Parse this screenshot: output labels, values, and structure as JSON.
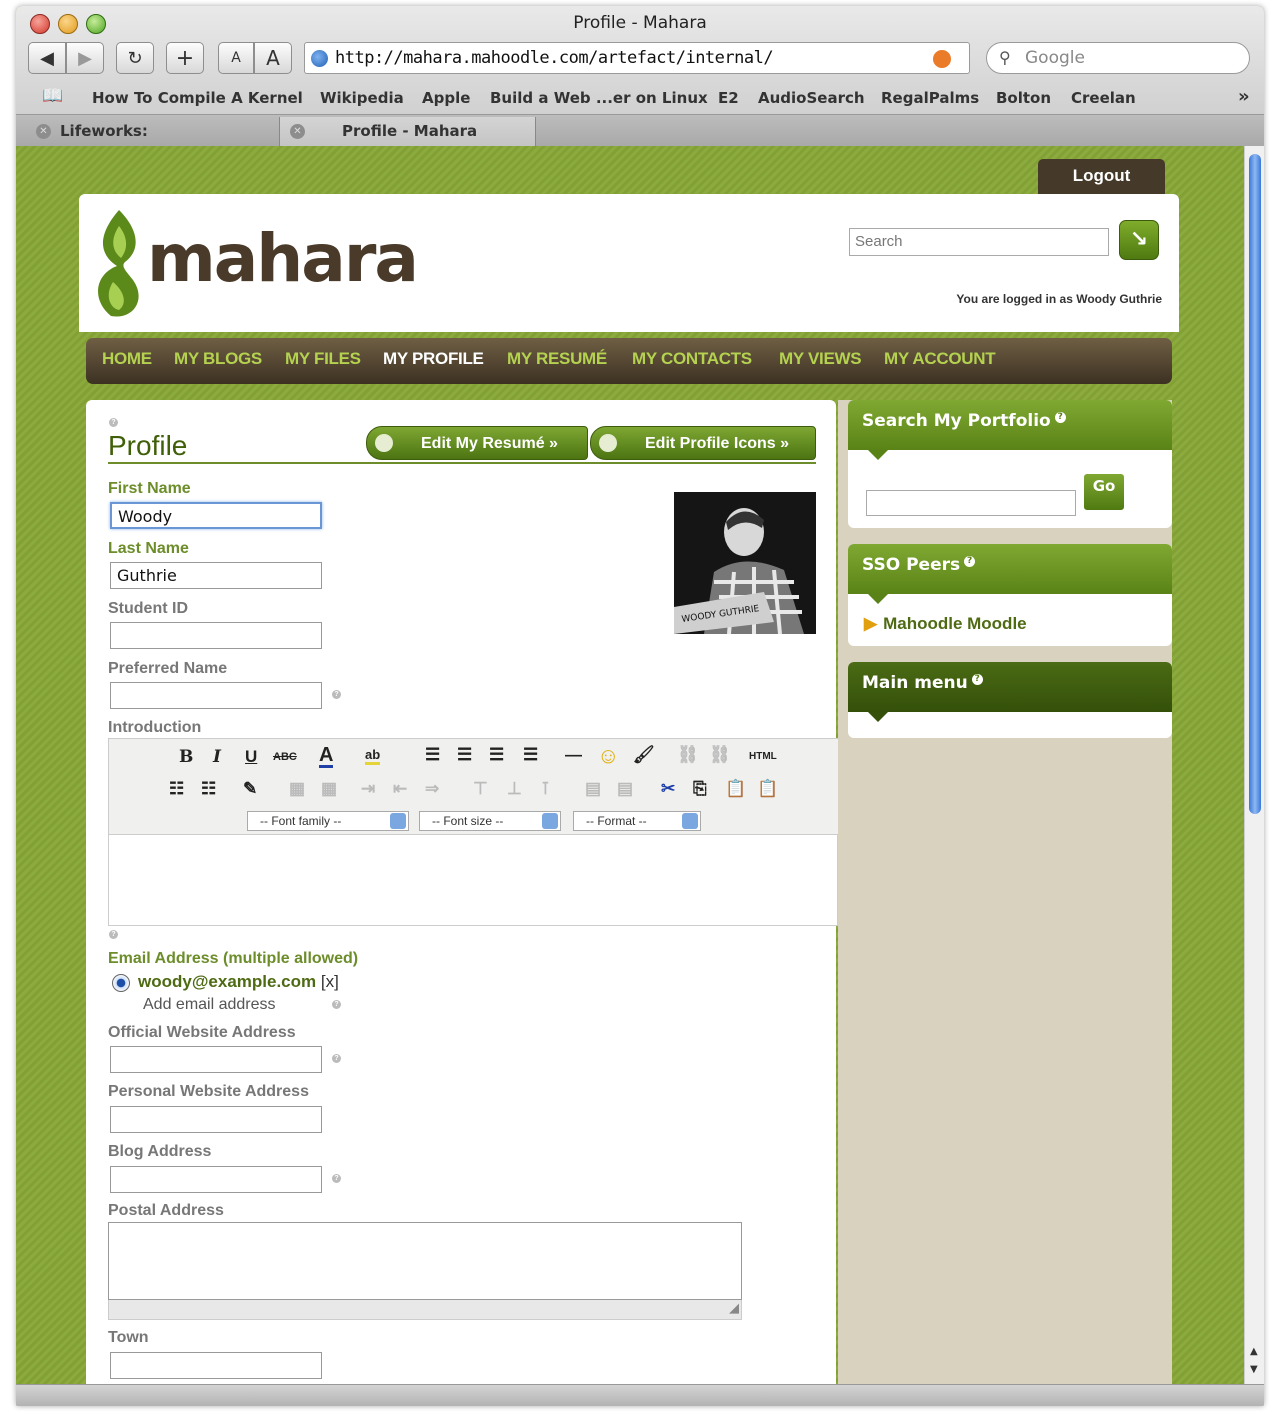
{
  "browser": {
    "window_title": "Profile - Mahara",
    "url": "http://mahara.mahoodle.com/artefact/internal/",
    "search_placeholder": "Google",
    "buttons": {
      "back": "◀",
      "forward": "▶",
      "reload": "↻",
      "add": "+",
      "text_smaller": "A",
      "text_larger": "A"
    },
    "bookmarks": [
      "How To Compile A Kernel",
      "Wikipedia",
      "Apple",
      "Build a Web ...er on Linux",
      "E2",
      "AudioSearch",
      "RegalPalms",
      "Bolton",
      "Creelan"
    ],
    "bookmarks_more": "»",
    "tabs": [
      {
        "label": "Lifeworks: Administratio...",
        "active": false
      },
      {
        "label": "Profile - Mahara",
        "active": true
      }
    ]
  },
  "site": {
    "logout": "Logout",
    "logo_text": "mahara",
    "search_placeholder": "Search",
    "logged_in_text": "You are logged in as Woody Guthrie",
    "nav": [
      "HOME",
      "MY BLOGS",
      "MY FILES",
      "MY PROFILE",
      "MY RESUMÉ",
      "MY CONTACTS",
      "MY VIEWS",
      "MY ACCOUNT"
    ],
    "nav_active": "MY PROFILE"
  },
  "profile": {
    "title": "Profile",
    "edit_resume_button": "Edit My Resumé »",
    "edit_icons_button": "Edit Profile Icons »",
    "help_glyph": "?",
    "fields": {
      "first_name": {
        "label": "First Name",
        "value": "Woody"
      },
      "last_name": {
        "label": "Last Name",
        "value": "Guthrie"
      },
      "student_id": {
        "label": "Student ID",
        "value": ""
      },
      "preferred_name": {
        "label": "Preferred Name",
        "value": ""
      },
      "introduction": {
        "label": "Introduction"
      },
      "email": {
        "label": "Email Address (multiple allowed)",
        "value": "woody@example.com",
        "remove": "[x]",
        "add_link": "Add email address"
      },
      "official_website": {
        "label": "Official Website Address",
        "value": ""
      },
      "personal_website": {
        "label": "Personal Website Address",
        "value": ""
      },
      "blog_address": {
        "label": "Blog Address",
        "value": ""
      },
      "postal_address": {
        "label": "Postal Address",
        "value": ""
      },
      "town": {
        "label": "Town",
        "value": ""
      }
    },
    "editor": {
      "font_family": "-- Font family --",
      "font_size": "-- Font size --",
      "format": "-- Format --",
      "html_button": "HTML",
      "bold": "B",
      "italic": "I",
      "underline": "U",
      "strike": "ABC"
    },
    "avatar_caption": "WOODY GUTHRIE"
  },
  "sidebar": {
    "search_portfolio": {
      "title": "Search My Portfolio",
      "go": "Go",
      "value": ""
    },
    "sso_peers": {
      "title": "SSO Peers",
      "items": [
        "Mahoodle Moodle"
      ]
    },
    "main_menu": {
      "title": "Main menu"
    }
  },
  "colors": {
    "brand_green": "#6c8d2a",
    "nav_brown": "#453a2a",
    "sidebar_dark_green": "#3d5a10"
  }
}
